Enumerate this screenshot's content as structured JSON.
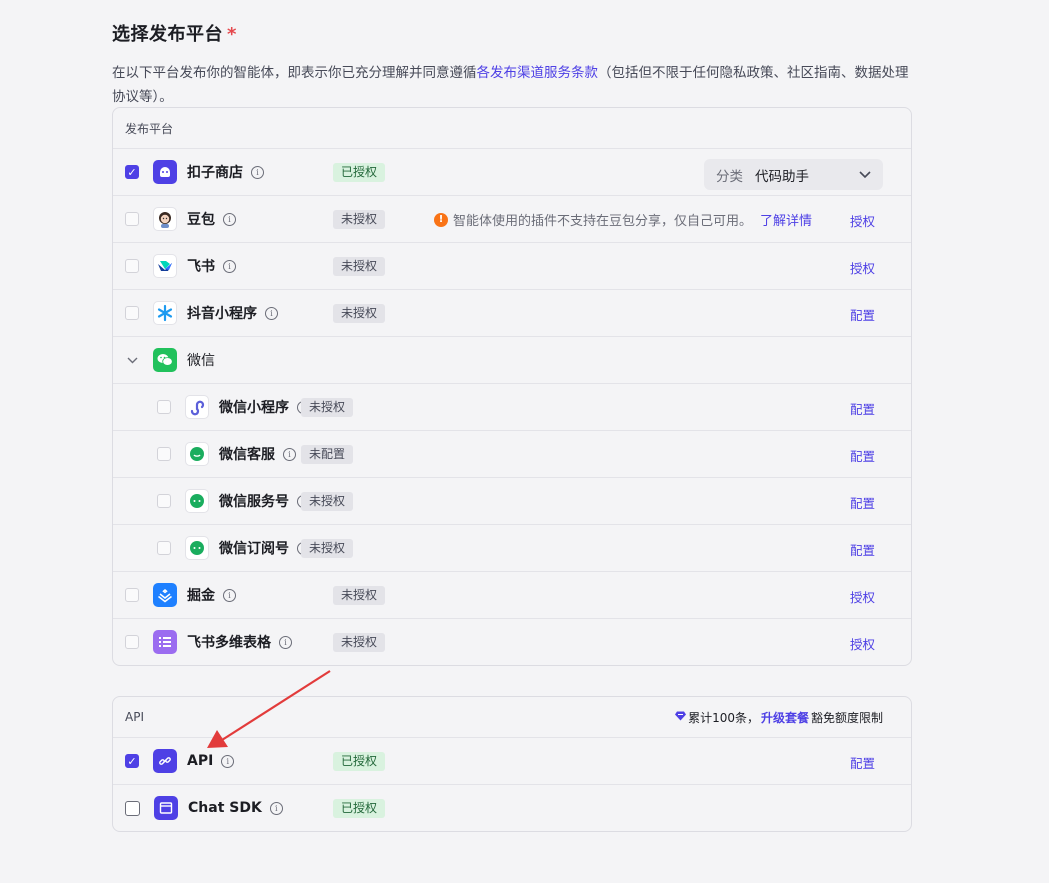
{
  "header": {
    "title": "选择发布平台",
    "required_mark": "*",
    "desc_prefix": "在以下平台发布你的智能体，即表示你已充分理解并同意遵循",
    "desc_link": "各发布渠道服务条款",
    "desc_suffix": "（包括但不限于任何隐私政策、社区指南、数据处理协议等）。"
  },
  "platforms": {
    "section_label": "发布平台",
    "rows": [
      {
        "name": "扣子商店",
        "badge": "已授权",
        "checked": true,
        "icon": "coze-store-icon",
        "select_label": "分类",
        "select_value": "代码助手"
      },
      {
        "name": "豆包",
        "badge": "未授权",
        "checked": false,
        "icon": "doubao-avatar-icon",
        "warning": "智能体使用的插件不支持在豆包分享，仅自己可用。",
        "warning_link": "了解详情",
        "action": "授权"
      },
      {
        "name": "飞书",
        "badge": "未授权",
        "checked": false,
        "icon": "feishu-icon",
        "action": "授权"
      },
      {
        "name": "抖音小程序",
        "badge": "未授权",
        "checked": false,
        "icon": "douyin-mini-program-icon",
        "action": "配置"
      },
      {
        "name": "微信",
        "icon": "wechat-icon",
        "expanded": true
      },
      {
        "name": "微信小程序",
        "badge": "未授权",
        "checked": false,
        "icon": "wechat-mini-program-icon",
        "action": "配置"
      },
      {
        "name": "微信客服",
        "badge": "未配置",
        "checked": false,
        "icon": "wechat-service-icon",
        "action": "配置"
      },
      {
        "name": "微信服务号",
        "badge": "未授权",
        "checked": false,
        "icon": "wechat-service-account-icon",
        "action": "配置"
      },
      {
        "name": "微信订阅号",
        "badge": "未授权",
        "checked": false,
        "icon": "wechat-subscription-icon",
        "action": "配置"
      },
      {
        "name": "掘金",
        "badge": "未授权",
        "checked": false,
        "icon": "juejin-icon",
        "action": "授权"
      },
      {
        "name": "飞书多维表格",
        "badge": "未授权",
        "checked": false,
        "icon": "feishu-bitable-icon",
        "action": "授权"
      }
    ]
  },
  "api_section": {
    "section_label": "API",
    "quota_prefix": "累计100条，",
    "quota_link": "升级套餐",
    "quota_suffix": "豁免额度限制",
    "rows": [
      {
        "name": "API",
        "badge": "已授权",
        "checked": true,
        "icon": "api-link-icon",
        "action": "配置"
      },
      {
        "name": "Chat SDK",
        "badge": "已授权",
        "checked": false,
        "icon": "chat-sdk-window-icon"
      }
    ]
  },
  "colors": {
    "accent": "#4e40e5",
    "authorized_bg": "#d9f2df",
    "authorized_text": "#23683a",
    "annotation_arrow": "#e23b3b",
    "warning": "#f97316"
  }
}
